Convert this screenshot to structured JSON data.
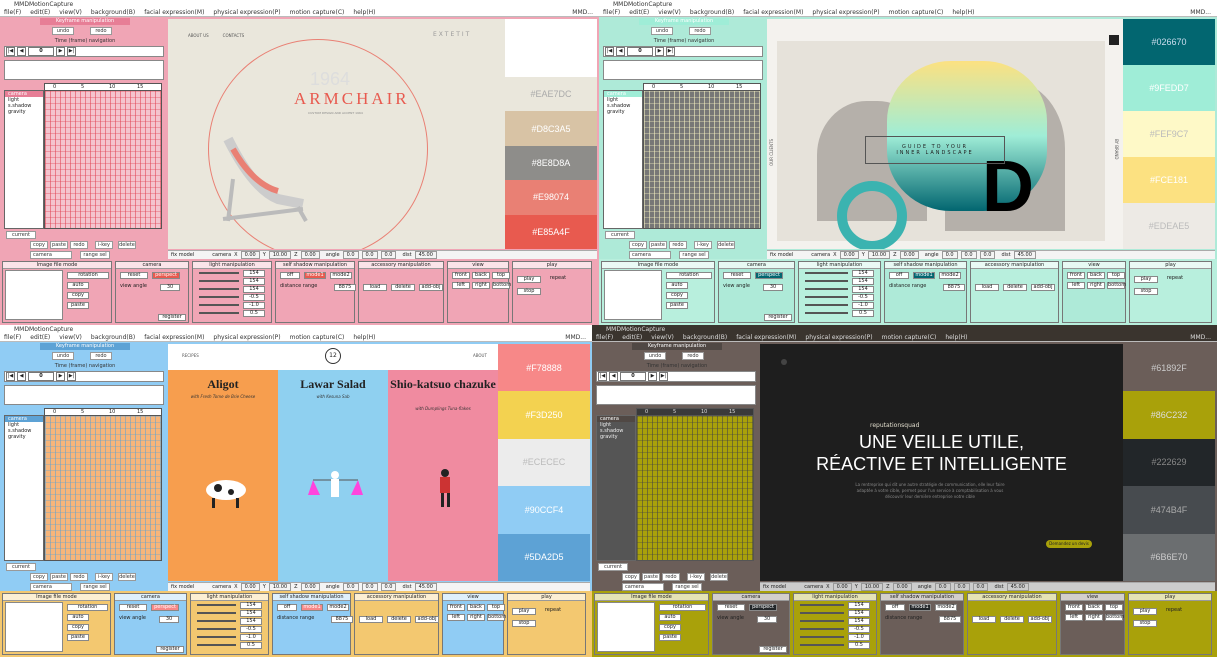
{
  "app": {
    "title": "MMDMotionCapture",
    "menu": [
      "file(F)",
      "edit(E)",
      "view(V)",
      "background(B)",
      "facial expression(M)",
      "physical expression(P)",
      "motion capture(C)",
      "help(H)"
    ],
    "version_right": "MMD..."
  },
  "left_panel": {
    "keyframe_title": "Keyframe manipulation",
    "undo": "undo",
    "redo": "redo",
    "timeline_title": "Time (frame) navigation",
    "frame_value": "0",
    "ruler": [
      "0",
      "5",
      "10",
      "15"
    ],
    "tracks": [
      "camera",
      "light",
      "s.shadow",
      "gravity"
    ],
    "current_btn": "current",
    "copy": "copy",
    "paste": "paste",
    "redo2": "redo",
    "ikey": "i-key",
    "delete": "delete",
    "camera_label": "camera",
    "range_label": "range sel"
  },
  "quadrants": [
    {
      "site_nav": [
        "ABOUT US",
        "CONTACTS"
      ],
      "brand": "EXTETIT",
      "year": "1964",
      "title": "ARMCHAIR",
      "sub": "CUSTOM DESIGN AND ACCENT 1964",
      "swatches": [
        {
          "hex": "#EAE7DC",
          "color": "#EAE7DC",
          "text": "#aaa"
        },
        {
          "hex": "#D8C3A5",
          "color": "#D8C3A5",
          "text": "#fff"
        },
        {
          "hex": "#8E8D8A",
          "color": "#8E8D8A",
          "text": "#fff"
        },
        {
          "hex": "#E98074",
          "color": "#E98074",
          "text": "#fff"
        },
        {
          "hex": "#E85A4F",
          "color": "#E85A4F",
          "text": "#fff"
        }
      ]
    },
    {
      "tagline1": "GUIDE TO YOUR",
      "tagline2": "INNER LANDSCAPE",
      "letter": "D",
      "left_side": "OUR CLIENTS",
      "right_side": "BY BRAND",
      "swatches": [
        {
          "hex": "#026670",
          "color": "#026670",
          "text": "#cde"
        },
        {
          "hex": "#9FEDD7",
          "color": "#9FEDD7",
          "text": "#fff"
        },
        {
          "hex": "#FEF9C7",
          "color": "#FEF9C7",
          "text": "#bbb"
        },
        {
          "hex": "#FCE181",
          "color": "#FCE181",
          "text": "#fff"
        },
        {
          "hex": "#EDEAE5",
          "color": "#EDEAE5",
          "text": "#bbb"
        }
      ]
    },
    {
      "nav_left": "RECIPES",
      "nav_right": "ABOUT",
      "logo": "12",
      "cards": [
        {
          "title": "Aligot",
          "sub": "with Fresh Tome de Brie Cheese",
          "bg": "#F79E4E"
        },
        {
          "title": "Lawar Salad",
          "sub": "with Kesuna Sab",
          "bg": "#8FD0F0"
        },
        {
          "title": "Shio-katsuo chazuke",
          "sub": "with Dumplings Tuna-flakes",
          "bg": "#F08BA0"
        }
      ],
      "swatches": [
        {
          "hex": "#F78888",
          "color": "#F78888",
          "text": "#fff"
        },
        {
          "hex": "#F3D250",
          "color": "#F3D250",
          "text": "#fff"
        },
        {
          "hex": "#ECECEC",
          "color": "#ECECEC",
          "text": "#bbb"
        },
        {
          "hex": "#90CCF4",
          "color": "#90CCF4",
          "text": "#fff"
        },
        {
          "hex": "#5DA2D5",
          "color": "#5DA2D5",
          "text": "#fff"
        }
      ]
    },
    {
      "brand": "reputationsquad",
      "h1": "UNE VEILLE UTILE,",
      "h2": "RÉACTIVE ET INTELLIGENTE",
      "body": "La rentreprise qui dit une autre stratégie de communication, elle leur faire adaptée à votre cible, permet pour l'un service à comptabilisation à vous découvrir leur dernière entreprise votre cible",
      "cta": "Demandez un devis",
      "swatches": [
        {
          "hex": "#61892F",
          "color": "#6B5E59",
          "text": "#ccc"
        },
        {
          "hex": "#86C232",
          "color": "#A9A10A",
          "text": "#ddd"
        },
        {
          "hex": "#222629",
          "color": "#222629",
          "text": "#888"
        },
        {
          "hex": "#474B4F",
          "color": "#474B4F",
          "text": "#aaa"
        },
        {
          "hex": "#6B6E70",
          "color": "#6B6E70",
          "text": "#ccc"
        }
      ]
    }
  ],
  "statusbar": {
    "mode": "fix model",
    "camera": "camera",
    "x": "X",
    "x_val": "0.00",
    "y": "Y",
    "y_val": "10.00",
    "z": "Z",
    "z_val": "0.00",
    "angle": "angle",
    "ax": "0.0",
    "ay": "0.0",
    "az": "0.0",
    "dist": "dist",
    "dist_val": "45.00"
  },
  "bottom": {
    "image_title": "Image file mode",
    "rotation": "rotation",
    "camera_light": "camera/light/accesso",
    "ok": "ok",
    "auto": "auto",
    "copy": "copy",
    "paste": "paste",
    "load": "load",
    "delete": "delete",
    "color": "color",
    "pattern": "pattern",
    "camera_title": "camera",
    "reset": "reset",
    "perspect": "perspect",
    "view_angle": "view angle",
    "va_val": "30",
    "register": "register",
    "light_title": "light manipulation",
    "light_vals": [
      "154",
      "154",
      "154",
      "-0.5",
      "-1.0",
      "0.5"
    ],
    "shadow_title": "self shadow manipulation",
    "off": "off",
    "mode1": "mode1",
    "mode2": "mode2",
    "distance": "distance range",
    "dist_val": "8875",
    "acc_title": "accessory manipulation",
    "add_obj": "add-obj",
    "view_title": "view",
    "front": "front",
    "back": "back",
    "top": "top",
    "left": "left",
    "right": "right",
    "bottom": "bottom",
    "track": "track",
    "play_title": "play",
    "play": "play",
    "repeat": "repeat",
    "stop": "stop",
    "from_fr": "from frame",
    "to_fr": "to frame"
  },
  "themes": [
    {
      "menu": "#ffffff",
      "panel": "#F0A5B5",
      "panelDark": "#E77E96",
      "grid": "#F4C4CE",
      "gridLine": "#E04050",
      "bottom": "#F0A5B5",
      "accent": "#E85A4F"
    },
    {
      "menu": "#ffffff",
      "panel": "#AEEAD8",
      "panelDark": "#9FEDD7",
      "grid": "#777777",
      "gridLine": "#FEF9C7",
      "bottom": "#B8EFDD",
      "accent": "#026670"
    },
    {
      "menu": "#ffffff",
      "panel": "#90CCF4",
      "panelDark": "#5DA2D5",
      "grid": "#F7B57A",
      "gridLine": "#5DA2D5",
      "bottom": "#F3C870",
      "accent": "#F78888"
    },
    {
      "menu": "#2e2a26",
      "panel": "#6B5E59",
      "panelDark": "#504844",
      "grid": "#A9A10A",
      "gridLine": "#444444",
      "bottom": "#A9A10A",
      "accent": "#222629"
    }
  ]
}
